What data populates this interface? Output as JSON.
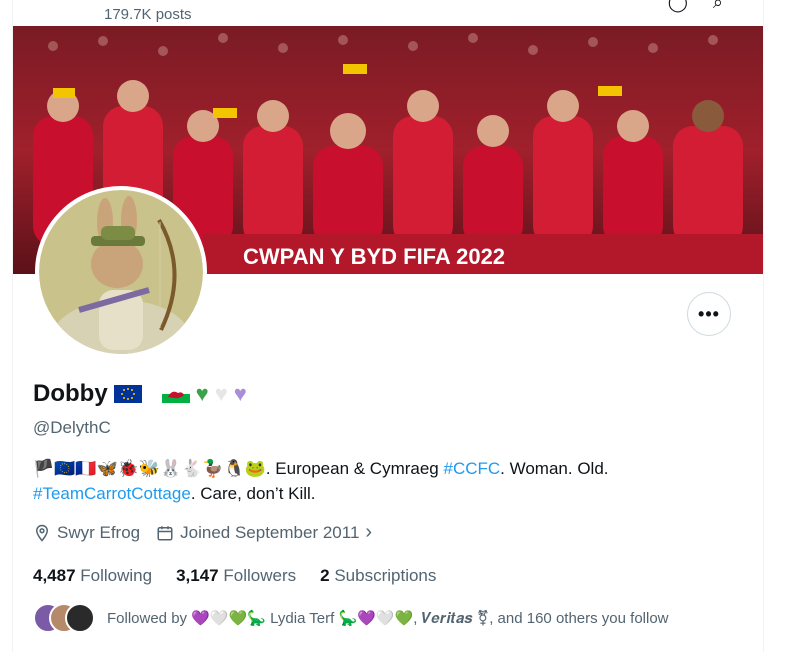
{
  "header": {
    "posts_count": "179.7K posts"
  },
  "profile": {
    "name": "Dobby",
    "name_emojis": [
      "🇪🇺",
      "🏴",
      "💚",
      "🤍",
      "💜"
    ],
    "handle": "@DelythC",
    "bio_emojis": "🏴🇪🇺🇫🇷🦋🐞🐝🐰🐇🦆🐧🐸",
    "bio_text_1": ". European & Cymraeg ",
    "bio_link_1": "#CCFC",
    "bio_text_2": ". Woman. Old.",
    "bio_link_2": "#TeamCarrotCottage",
    "bio_text_3": ". Care, don’t Kill.",
    "location": "Swyr Efrog",
    "joined": "Joined September 2011",
    "following_count": "4,487",
    "following_label": "Following",
    "followers_count": "3,147",
    "followers_label": "Followers",
    "subscriptions_count": "2",
    "subscriptions_label": "Subscriptions",
    "followed_by_prefix": "Followed by",
    "followed_by_emojis_1": "💜🤍💚🦕",
    "followed_by_name_1": "Lydia Terf",
    "followed_by_emojis_2": "🦕💜🤍💚",
    "followed_by_name_2": "𝑽𝒆𝒓𝒊𝒕𝒂𝒔 ⚧",
    "followed_by_suffix": ", and 160 others you follow"
  },
  "banner_text": "CWPAN Y BYD FIFA 2022",
  "colors": {
    "link": "#1d9bf0",
    "secondary": "#536471",
    "primary": "#0f1419",
    "welsh_red": "#c8102e"
  },
  "icons": {
    "location": "map-pin-icon",
    "calendar": "calendar-icon",
    "more": "more-options-icon"
  }
}
